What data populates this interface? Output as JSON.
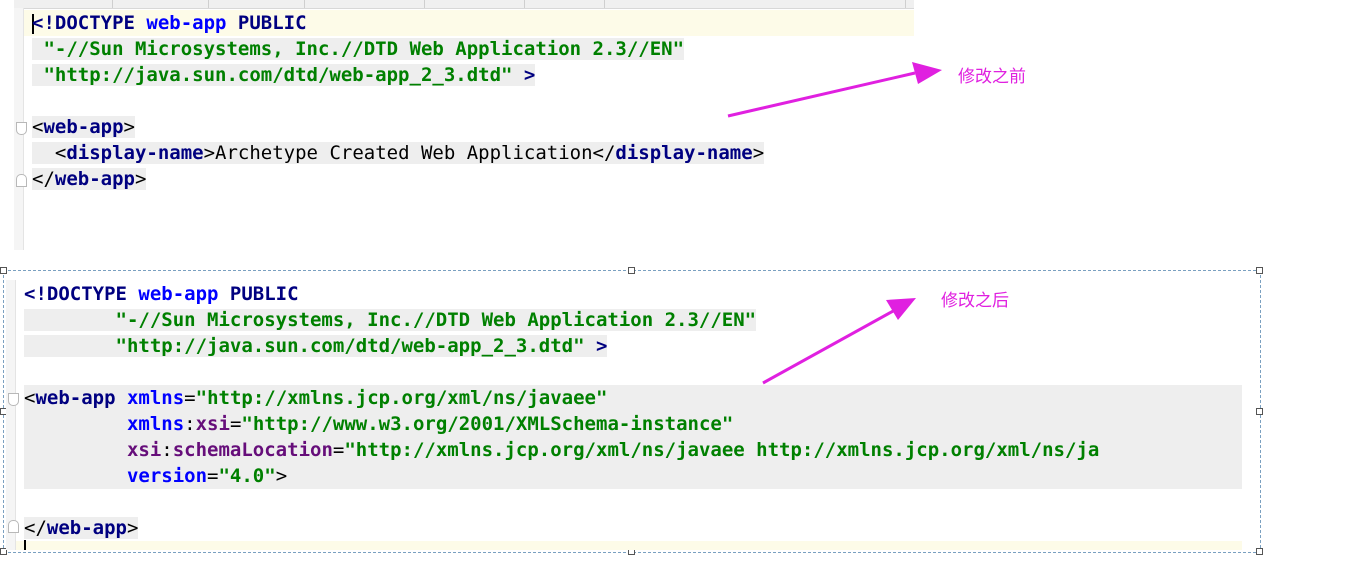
{
  "before": {
    "lines": [
      [
        {
          "t": "<!DOCTYPE ",
          "c": "kw"
        },
        {
          "t": "web-app",
          "c": "attr"
        },
        {
          "t": " PUBLIC",
          "c": "kw"
        }
      ],
      [
        {
          "t": " ",
          "c": "txt"
        },
        {
          "t": "\"-//Sun Microsystems, Inc.//DTD Web Application 2.3//EN\"",
          "c": "str"
        }
      ],
      [
        {
          "t": " ",
          "c": "txt"
        },
        {
          "t": "\"http://java.sun.com/dtd/web-app_2_3.dtd\"",
          "c": "str"
        },
        {
          "t": " >",
          "c": "kw"
        }
      ],
      [],
      [
        {
          "t": "<",
          "c": "txt"
        },
        {
          "t": "web-app",
          "c": "tag"
        },
        {
          "t": ">",
          "c": "txt"
        }
      ],
      [
        {
          "t": "  <",
          "c": "txt"
        },
        {
          "t": "display-name",
          "c": "tag"
        },
        {
          "t": ">Archetype Created Web Application</",
          "c": "txt"
        },
        {
          "t": "display-name",
          "c": "tag"
        },
        {
          "t": ">",
          "c": "txt"
        }
      ],
      [
        {
          "t": "</",
          "c": "txt"
        },
        {
          "t": "web-app",
          "c": "tag"
        },
        {
          "t": ">",
          "c": "txt"
        }
      ]
    ]
  },
  "after": {
    "lines": [
      [
        {
          "t": "<!DOCTYPE ",
          "c": "kw"
        },
        {
          "t": "web-app",
          "c": "attr"
        },
        {
          "t": " PUBLIC",
          "c": "kw"
        }
      ],
      [
        {
          "t": "        ",
          "c": "txt"
        },
        {
          "t": "\"-//Sun Microsystems, Inc.//DTD Web Application 2.3//EN\"",
          "c": "str"
        }
      ],
      [
        {
          "t": "        ",
          "c": "txt"
        },
        {
          "t": "\"http://java.sun.com/dtd/web-app_2_3.dtd\"",
          "c": "str"
        },
        {
          "t": " >",
          "c": "kw"
        }
      ],
      [],
      [
        {
          "t": "<",
          "c": "txt"
        },
        {
          "t": "web-app ",
          "c": "tag"
        },
        {
          "t": "xmlns",
          "c": "attr"
        },
        {
          "t": "=",
          "c": "txt"
        },
        {
          "t": "\"http://xmlns.jcp.org/xml/ns/javaee\"",
          "c": "str"
        }
      ],
      [
        {
          "t": "         ",
          "c": "txt"
        },
        {
          "t": "xmlns",
          "c": "attr"
        },
        {
          "t": ":",
          "c": "txt"
        },
        {
          "t": "xsi",
          "c": "ns"
        },
        {
          "t": "=",
          "c": "txt"
        },
        {
          "t": "\"http://www.w3.org/2001/XMLSchema-instance\"",
          "c": "str"
        }
      ],
      [
        {
          "t": "         ",
          "c": "txt"
        },
        {
          "t": "xsi",
          "c": "ns"
        },
        {
          "t": ":",
          "c": "txt"
        },
        {
          "t": "schemaLocation",
          "c": "ns"
        },
        {
          "t": "=",
          "c": "txt"
        },
        {
          "t": "\"http://xmlns.jcp.org/xml/ns/javaee http://xmlns.jcp.org/xml/ns/ja",
          "c": "str"
        }
      ],
      [
        {
          "t": "         ",
          "c": "txt"
        },
        {
          "t": "version",
          "c": "attr"
        },
        {
          "t": "=",
          "c": "txt"
        },
        {
          "t": "\"4.0\"",
          "c": "str"
        },
        {
          "t": ">",
          "c": "txt"
        }
      ],
      [],
      [
        {
          "t": "</",
          "c": "txt"
        },
        {
          "t": "web-app",
          "c": "tag"
        },
        {
          "t": ">",
          "c": "txt"
        }
      ],
      []
    ]
  },
  "annotations": {
    "before_label": "修改之前",
    "after_label": "修改之后",
    "arrow_color": "#e020e0"
  }
}
